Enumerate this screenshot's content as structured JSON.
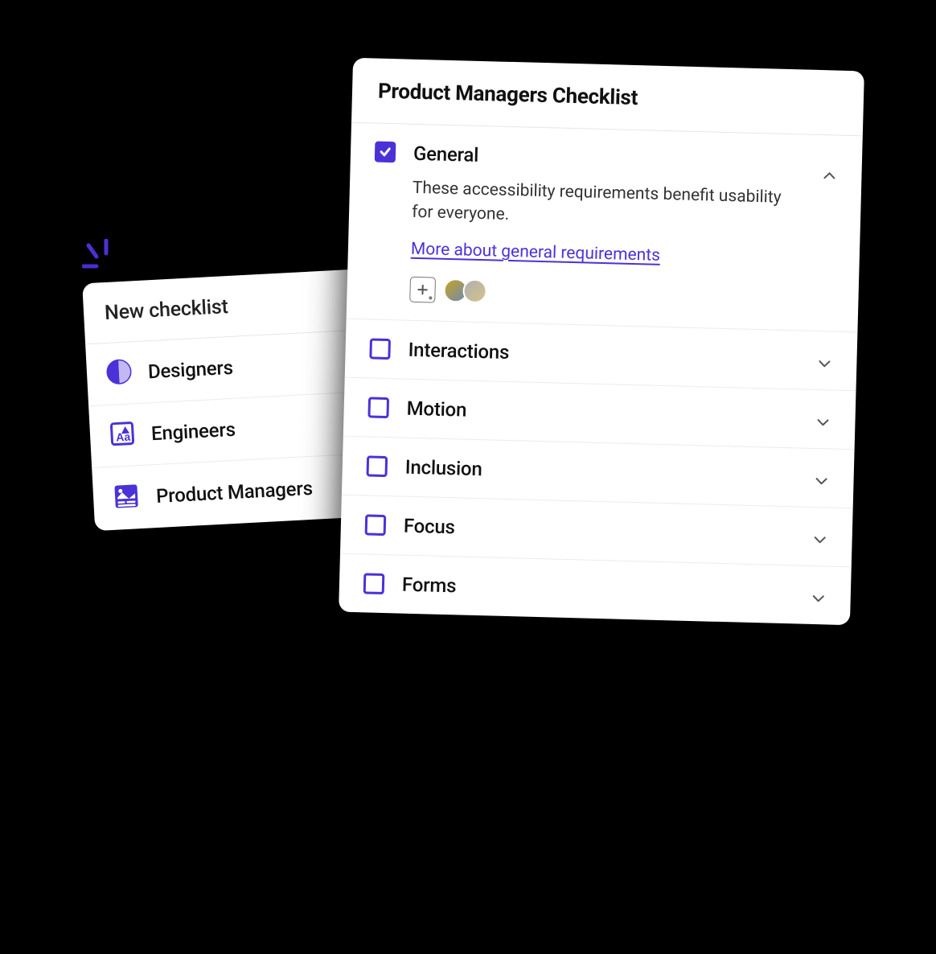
{
  "colors": {
    "accent": "#4A32D8"
  },
  "left_card": {
    "title": "New checklist",
    "roles": [
      {
        "icon": "contrast-icon",
        "label": "Designers"
      },
      {
        "icon": "typography-icon",
        "label": "Engineers"
      },
      {
        "icon": "layout-icon",
        "label": "Product Managers"
      }
    ]
  },
  "right_card": {
    "title": "Product Managers Checklist",
    "sections": [
      {
        "checked": true,
        "expanded": true,
        "title": "General",
        "description": "These accessibility requirements benefit usability for everyone.",
        "link_label": "More about general requirements",
        "collaborators": 2
      },
      {
        "checked": false,
        "expanded": false,
        "title": "Interactions"
      },
      {
        "checked": false,
        "expanded": false,
        "title": "Motion"
      },
      {
        "checked": false,
        "expanded": false,
        "title": "Inclusion"
      },
      {
        "checked": false,
        "expanded": false,
        "title": "Focus"
      },
      {
        "checked": false,
        "expanded": false,
        "title": "Forms"
      }
    ]
  }
}
